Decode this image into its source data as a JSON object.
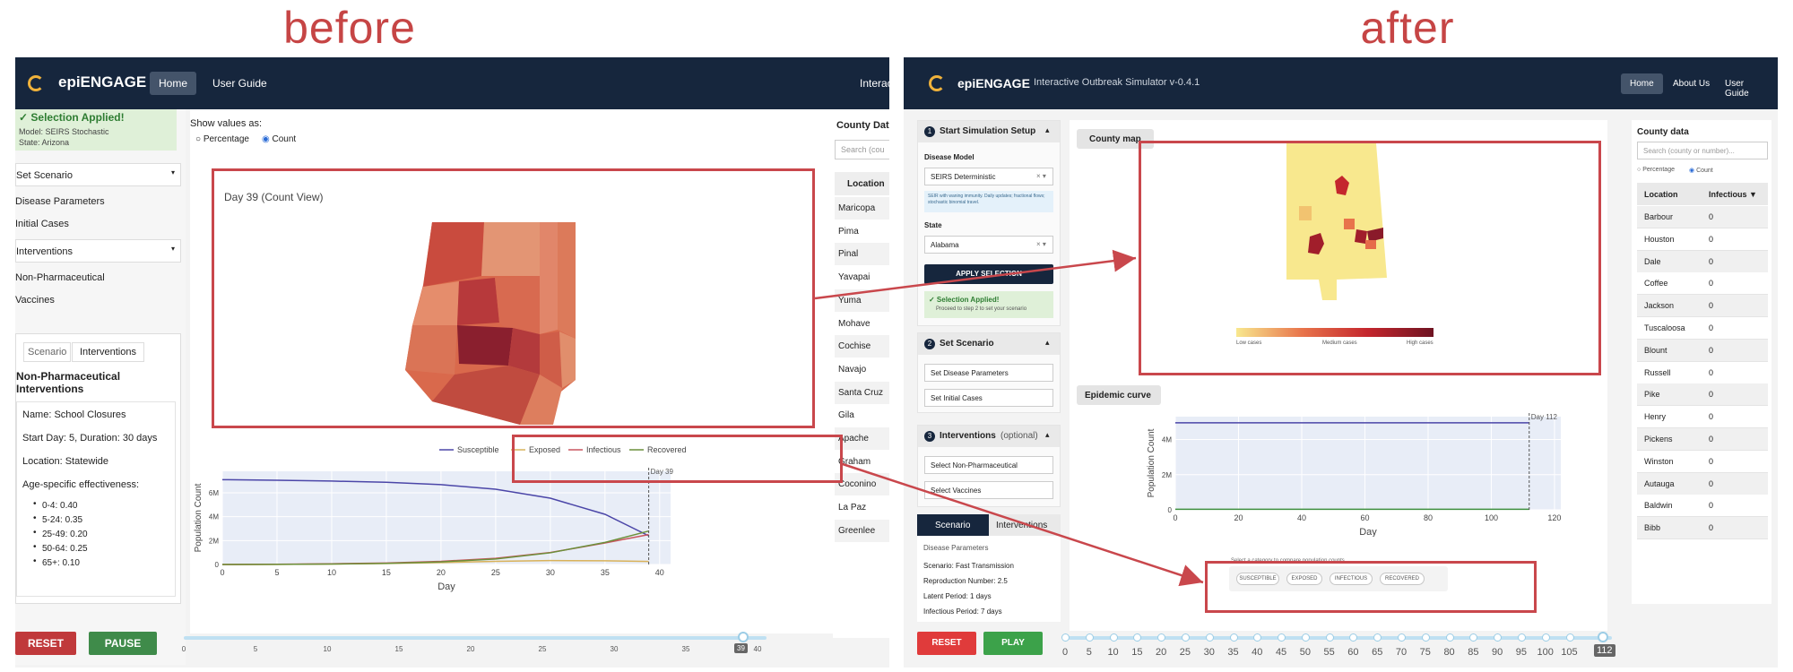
{
  "titles": {
    "before": "before",
    "after": "after"
  },
  "before": {
    "nav": {
      "brand": "epiENGAGE",
      "home": "Home",
      "guide": "User Guide",
      "cut": "Interact"
    },
    "selection": {
      "title": "✓ Selection Applied!",
      "model": "Model: SEIRS Stochastic",
      "state": "State: Arizona"
    },
    "sidebar": {
      "set_scenario": "Set Scenario",
      "disease_parameters": "Disease Parameters",
      "initial_cases": "Initial Cases",
      "interventions": "Interventions",
      "non_pharma": "Non-Pharmaceutical",
      "vaccines": "Vaccines"
    },
    "tabs": {
      "scenario": "Scenario",
      "interventions": "Interventions"
    },
    "npi": {
      "title_line1": "Non-Pharmaceutical",
      "title_line2": "Interventions",
      "name": "Name: School Closures",
      "start": "Start Day: 5, Duration: 30 days",
      "location": "Location: Statewide",
      "age_title": "Age-specific effectiveness:",
      "ages": [
        "0-4: 0.40",
        "5-24: 0.35",
        "25-49: 0.20",
        "50-64: 0.25",
        "65+: 0.10"
      ]
    },
    "show_values": {
      "label": "Show values as:",
      "percentage": "Percentage",
      "count": "Count"
    },
    "map_title": "Day 39 (Count View)",
    "county": {
      "title": "County Data",
      "search_placeholder": "Search (cou",
      "header": "Location",
      "rows": [
        "Maricopa",
        "Pima",
        "Pinal",
        "Yavapai",
        "Yuma",
        "Mohave",
        "Cochise",
        "Navajo",
        "Santa Cruz",
        "Gila",
        "Apache",
        "Graham",
        "Coconino",
        "La Paz",
        "Greenlee"
      ]
    },
    "buttons": {
      "reset": "RESET",
      "pause": "PAUSE"
    },
    "slider": {
      "labels": [
        "0",
        "5",
        "10",
        "15",
        "20",
        "25",
        "30",
        "35",
        "40"
      ],
      "current": "39",
      "max": 40
    },
    "chart_data": {
      "type": "line",
      "x": [
        0,
        5,
        10,
        15,
        20,
        25,
        30,
        35,
        39
      ],
      "series": [
        {
          "name": "Susceptible",
          "color": "#4b46a8",
          "values": [
            7100000,
            7050000,
            6980000,
            6880000,
            6680000,
            6300000,
            5550000,
            4200000,
            2400000
          ]
        },
        {
          "name": "Exposed",
          "color": "#d9b25a",
          "values": [
            0,
            10000,
            40000,
            80000,
            160000,
            260000,
            330000,
            310000,
            250000
          ]
        },
        {
          "name": "Infectious",
          "color": "#c9565f",
          "values": [
            0,
            20000,
            60000,
            120000,
            260000,
            520000,
            1000000,
            1800000,
            2500000
          ]
        },
        {
          "name": "Recovered",
          "color": "#6b8f3a",
          "values": [
            0,
            10000,
            40000,
            90000,
            220000,
            460000,
            980000,
            1850000,
            2800000
          ]
        }
      ],
      "xlabel": "Day",
      "ylabel": "Population Count",
      "xticks": [
        0,
        5,
        10,
        15,
        20,
        25,
        30,
        35,
        40
      ],
      "yticks": [
        "0",
        "2M",
        "4M",
        "6M"
      ],
      "xlim": [
        0,
        41
      ],
      "ylim": [
        0,
        7800000
      ],
      "marker_day": 39,
      "marker_label": "Day 39"
    }
  },
  "after": {
    "nav": {
      "brand": "epiENGAGE",
      "sub": "Interactive Outbreak Simulator v-0.4.1",
      "home": "Home",
      "about": "About Us",
      "guide": "User Guide"
    },
    "step1": {
      "num": "1",
      "title": "Start Simulation Setup",
      "model_label": "Disease Model",
      "model_value": "SEIRS Deterministic",
      "model_desc": "SEIR with waning immunity. Daily updates; fractional flows; stochastic binomial travel.",
      "state_label": "State",
      "state_value": "Alabama",
      "apply": "APPLY SELECTION",
      "applied_title": "✓ Selection Applied!",
      "applied_sub": "Proceed to step 2 to set your scenario"
    },
    "step2": {
      "num": "2",
      "title": "Set Scenario",
      "disease": "Set Disease Parameters",
      "initial": "Set Initial Cases"
    },
    "step3": {
      "num": "3",
      "title": "Interventions",
      "optional": "(optional)",
      "npi": "Select Non-Pharmaceutical",
      "vaccines": "Select Vaccines"
    },
    "tabs": {
      "scenario": "Scenario",
      "interventions": "Interventions"
    },
    "params": {
      "header": "Disease Parameters",
      "scenario": "Scenario: Fast Transmission",
      "r0": "Reproduction Number: 2.5",
      "latent": "Latent Period: 1 days",
      "infectious": "Infectious Period: 7 days"
    },
    "county_map_tab": "County map",
    "legend": {
      "low": "Low cases",
      "medium": "Medium cases",
      "high": "High cases"
    },
    "epi_tab": "Epidemic curve",
    "compare_text": "Select a category to compare population counts",
    "chips": [
      "SUSCEPTIBLE",
      "EXPOSED",
      "INFECTIOUS",
      "RECOVERED"
    ],
    "county": {
      "title": "County data",
      "search_placeholder": "Search (county or number)...",
      "percentage": "Percentage",
      "count": "Count",
      "col_location": "Location",
      "col_infectious": "Infectious ▼",
      "rows": [
        {
          "name": "Barbour",
          "value": "0"
        },
        {
          "name": "Houston",
          "value": "0"
        },
        {
          "name": "Dale",
          "value": "0"
        },
        {
          "name": "Coffee",
          "value": "0"
        },
        {
          "name": "Jackson",
          "value": "0"
        },
        {
          "name": "Tuscaloosa",
          "value": "0"
        },
        {
          "name": "Blount",
          "value": "0"
        },
        {
          "name": "Russell",
          "value": "0"
        },
        {
          "name": "Pike",
          "value": "0"
        },
        {
          "name": "Henry",
          "value": "0"
        },
        {
          "name": "Pickens",
          "value": "0"
        },
        {
          "name": "Winston",
          "value": "0"
        },
        {
          "name": "Autauga",
          "value": "0"
        },
        {
          "name": "Baldwin",
          "value": "0"
        },
        {
          "name": "Bibb",
          "value": "0"
        }
      ]
    },
    "buttons": {
      "reset": "RESET",
      "play": "PLAY"
    },
    "slider": {
      "labels": [
        "0",
        "5",
        "10",
        "15",
        "20",
        "25",
        "30",
        "35",
        "40",
        "45",
        "50",
        "55",
        "60",
        "65",
        "70",
        "75",
        "80",
        "85",
        "90",
        "95",
        "100",
        "105"
      ],
      "current": "112",
      "max": 112
    },
    "chart_data": {
      "type": "line",
      "x": [
        0,
        20,
        40,
        60,
        80,
        100,
        112
      ],
      "series": [
        {
          "color": "#4b46a8",
          "values": [
            4950000,
            4950000,
            4950000,
            4950000,
            4950000,
            4950000,
            4950000
          ]
        },
        {
          "color": "#3f8f3f",
          "values": [
            30000,
            30000,
            30000,
            30000,
            30000,
            30000,
            30000
          ]
        }
      ],
      "xlabel": "Day",
      "ylabel": "Population Count",
      "xticks": [
        0,
        20,
        40,
        60,
        80,
        100,
        120
      ],
      "yticks": [
        "0",
        "2M",
        "4M"
      ],
      "xlim": [
        0,
        122
      ],
      "ylim": [
        0,
        5300000
      ],
      "marker_day": 112,
      "marker_label": "Day 112"
    }
  },
  "colors": {
    "accent_red": "#c9474c",
    "nav": "#16263d",
    "reset": "#c0393b",
    "pause": "#3f8b4a"
  }
}
